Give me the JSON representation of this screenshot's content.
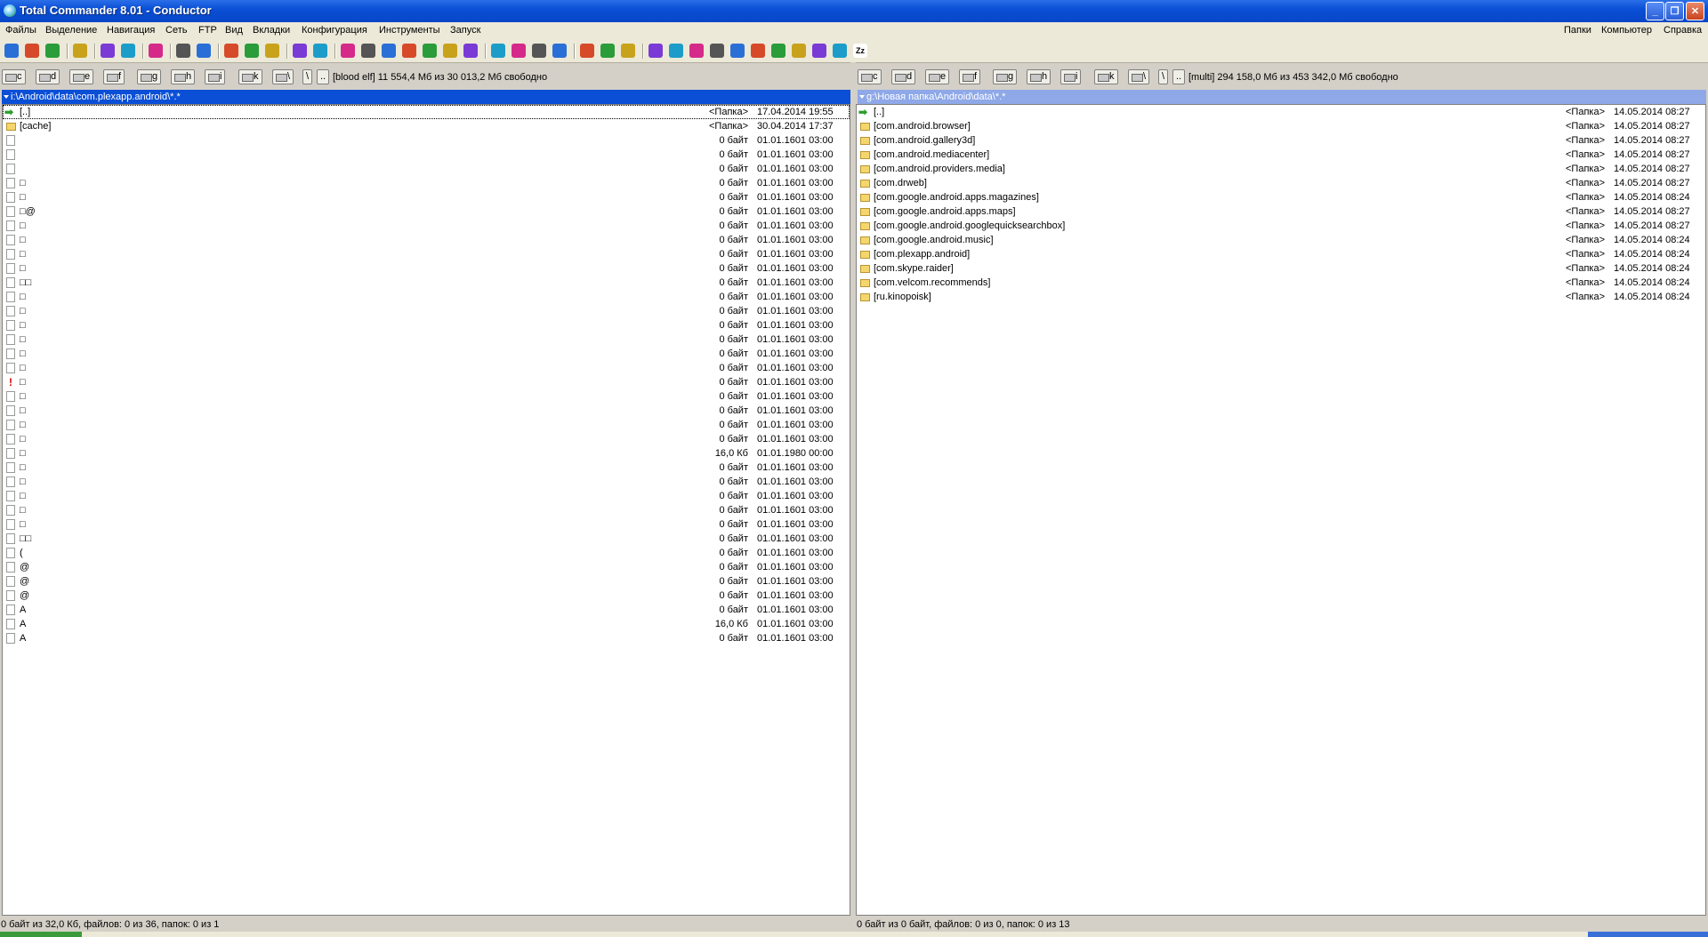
{
  "window": {
    "title": "Total Commander 8.01 - Conductor",
    "min": "_",
    "max": "❐",
    "close": "✕"
  },
  "menu": {
    "left": [
      "Файлы",
      "Выделение",
      "Навигация",
      "Сеть",
      "FTP",
      "Вид",
      "Вкладки",
      "Конфигурация",
      "Инструменты",
      "Запуск"
    ],
    "right": [
      "Папки",
      "Компьютер",
      "Справка"
    ]
  },
  "toolbar": {
    "icons": [
      "gear-icon",
      "gear-icon",
      "gear-icon",
      "refresh-icon",
      "back-icon",
      "forward-icon",
      "search-icon",
      "copy-icon",
      "move-icon",
      "star-icon",
      "sort-icon",
      "clipboard-icon",
      "compare-icon",
      "trophy-icon",
      "edit-icon",
      "zoom-icon",
      "file-icon",
      "flag-icon",
      "target-icon",
      "folder-icon",
      "tools-icon",
      "box-icon",
      "users-icon",
      "drive-icon",
      "hex-icon",
      "pen-icon",
      "plus-icon",
      "package-icon",
      "disc-icon",
      "camera-icon",
      "clock-icon",
      "film-icon",
      "image-icon",
      "media-icon",
      "film2-icon",
      "notes-icon",
      "folder2-icon",
      "blue-icon",
      "zip-icon"
    ],
    "zip_label": "Zz"
  },
  "left": {
    "drives": [
      "c",
      "d",
      "e",
      "f",
      "g",
      "h",
      "i",
      "k"
    ],
    "net": "\\",
    "root": "\\",
    "up": "..",
    "info": "[blood elf]  11 554,4 Мб из 30 013,2 Мб свободно",
    "path": "i:\\Android\\data\\com.plexapp.android\\*.*",
    "rows": [
      {
        "icon": "up",
        "name": "[..]",
        "size": "<Папка>",
        "date": "17.04.2014 19:55"
      },
      {
        "icon": "folder",
        "name": "[cache]",
        "size": "<Папка>",
        "date": "30.04.2014 17:37"
      },
      {
        "icon": "file",
        "name": "",
        "size": "0 байт",
        "date": "01.01.1601 03:00"
      },
      {
        "icon": "file",
        "name": "",
        "size": "0 байт",
        "date": "01.01.1601 03:00"
      },
      {
        "icon": "file",
        "name": "",
        "size": "0 байт",
        "date": "01.01.1601 03:00"
      },
      {
        "icon": "file",
        "name": "□",
        "size": "0 байт",
        "date": "01.01.1601 03:00"
      },
      {
        "icon": "file",
        "name": "□",
        "size": "0 байт",
        "date": "01.01.1601 03:00"
      },
      {
        "icon": "file",
        "name": "□@",
        "size": "0 байт",
        "date": "01.01.1601 03:00"
      },
      {
        "icon": "file",
        "name": "□",
        "size": "0 байт",
        "date": "01.01.1601 03:00"
      },
      {
        "icon": "file",
        "name": "□",
        "size": "0 байт",
        "date": "01.01.1601 03:00"
      },
      {
        "icon": "file",
        "name": "□",
        "size": "0 байт",
        "date": "01.01.1601 03:00"
      },
      {
        "icon": "file",
        "name": "□",
        "size": "0 байт",
        "date": "01.01.1601 03:00"
      },
      {
        "icon": "file",
        "name": "□□",
        "size": "0 байт",
        "date": "01.01.1601 03:00"
      },
      {
        "icon": "file",
        "name": "□",
        "size": "0 байт",
        "date": "01.01.1601 03:00"
      },
      {
        "icon": "file",
        "name": "□",
        "size": "0 байт",
        "date": "01.01.1601 03:00"
      },
      {
        "icon": "file",
        "name": "□",
        "size": "0 байт",
        "date": "01.01.1601 03:00"
      },
      {
        "icon": "file",
        "name": "□",
        "size": "0 байт",
        "date": "01.01.1601 03:00"
      },
      {
        "icon": "file",
        "name": "□",
        "size": "0 байт",
        "date": "01.01.1601 03:00"
      },
      {
        "icon": "file",
        "name": "□",
        "size": "0 байт",
        "date": "01.01.1601 03:00"
      },
      {
        "icon": "warn",
        "name": "□",
        "size": "0 байт",
        "date": "01.01.1601 03:00"
      },
      {
        "icon": "file",
        "name": "□",
        "size": "0 байт",
        "date": "01.01.1601 03:00"
      },
      {
        "icon": "file",
        "name": "□",
        "size": "0 байт",
        "date": "01.01.1601 03:00"
      },
      {
        "icon": "file",
        "name": "□",
        "size": "0 байт",
        "date": "01.01.1601 03:00"
      },
      {
        "icon": "file",
        "name": "□",
        "size": "0 байт",
        "date": "01.01.1601 03:00"
      },
      {
        "icon": "file",
        "name": "□",
        "size": "16,0 Кб",
        "date": "01.01.1980 00:00"
      },
      {
        "icon": "file",
        "name": "□",
        "size": "0 байт",
        "date": "01.01.1601 03:00"
      },
      {
        "icon": "file",
        "name": "□",
        "size": "0 байт",
        "date": "01.01.1601 03:00"
      },
      {
        "icon": "file",
        "name": "□",
        "size": "0 байт",
        "date": "01.01.1601 03:00"
      },
      {
        "icon": "file",
        "name": "□",
        "size": "0 байт",
        "date": "01.01.1601 03:00"
      },
      {
        "icon": "file",
        "name": "□",
        "size": "0 байт",
        "date": "01.01.1601 03:00"
      },
      {
        "icon": "file",
        "name": "□□",
        "size": "0 байт",
        "date": "01.01.1601 03:00"
      },
      {
        "icon": "file",
        "name": "(",
        "size": "0 байт",
        "date": "01.01.1601 03:00"
      },
      {
        "icon": "file",
        "name": "@",
        "size": "0 байт",
        "date": "01.01.1601 03:00"
      },
      {
        "icon": "file",
        "name": "@",
        "size": "0 байт",
        "date": "01.01.1601 03:00"
      },
      {
        "icon": "file",
        "name": "@",
        "size": "0 байт",
        "date": "01.01.1601 03:00"
      },
      {
        "icon": "file",
        "name": "A",
        "size": "0 байт",
        "date": "01.01.1601 03:00"
      },
      {
        "icon": "file",
        "name": "A",
        "size": "16,0 Кб",
        "date": "01.01.1601 03:00"
      },
      {
        "icon": "file",
        "name": "A",
        "size": "0 байт",
        "date": "01.01.1601 03:00"
      }
    ],
    "status": "0 байт из 32,0 Кб, файлов: 0 из 36, папок: 0 из 1"
  },
  "right": {
    "drives": [
      "c",
      "d",
      "e",
      "f",
      "g",
      "h",
      "i",
      "k"
    ],
    "net": "\\",
    "root": "\\",
    "up": "..",
    "info": "[multi]  294 158,0 Мб из 453 342,0 Мб свободно",
    "path": "g:\\Новая папка\\Android\\data\\*.*",
    "rows": [
      {
        "icon": "up",
        "name": "[..]",
        "size": "<Папка>",
        "date": "14.05.2014 08:27"
      },
      {
        "icon": "folder",
        "name": "[com.android.browser]",
        "size": "<Папка>",
        "date": "14.05.2014 08:27"
      },
      {
        "icon": "folder",
        "name": "[com.android.gallery3d]",
        "size": "<Папка>",
        "date": "14.05.2014 08:27"
      },
      {
        "icon": "folder",
        "name": "[com.android.mediacenter]",
        "size": "<Папка>",
        "date": "14.05.2014 08:27"
      },
      {
        "icon": "folder",
        "name": "[com.android.providers.media]",
        "size": "<Папка>",
        "date": "14.05.2014 08:27"
      },
      {
        "icon": "folder",
        "name": "[com.drweb]",
        "size": "<Папка>",
        "date": "14.05.2014 08:27"
      },
      {
        "icon": "folder",
        "name": "[com.google.android.apps.magazines]",
        "size": "<Папка>",
        "date": "14.05.2014 08:24"
      },
      {
        "icon": "folder",
        "name": "[com.google.android.apps.maps]",
        "size": "<Папка>",
        "date": "14.05.2014 08:27"
      },
      {
        "icon": "folder",
        "name": "[com.google.android.googlequicksearchbox]",
        "size": "<Папка>",
        "date": "14.05.2014 08:27"
      },
      {
        "icon": "folder",
        "name": "[com.google.android.music]",
        "size": "<Папка>",
        "date": "14.05.2014 08:24"
      },
      {
        "icon": "folder",
        "name": "[com.plexapp.android]",
        "size": "<Папка>",
        "date": "14.05.2014 08:24"
      },
      {
        "icon": "folder",
        "name": "[com.skype.raider]",
        "size": "<Папка>",
        "date": "14.05.2014 08:24"
      },
      {
        "icon": "folder",
        "name": "[com.velcom.recommends]",
        "size": "<Папка>",
        "date": "14.05.2014 08:24"
      },
      {
        "icon": "folder",
        "name": "[ru.kinopoisk]",
        "size": "<Папка>",
        "date": "14.05.2014 08:24"
      }
    ],
    "status": "0 байт из 0 байт, файлов: 0 из 0, папок: 0 из 13"
  },
  "colors": {
    "active_path": "#0a4fd6",
    "inactive_path": "#8ea8e8"
  }
}
